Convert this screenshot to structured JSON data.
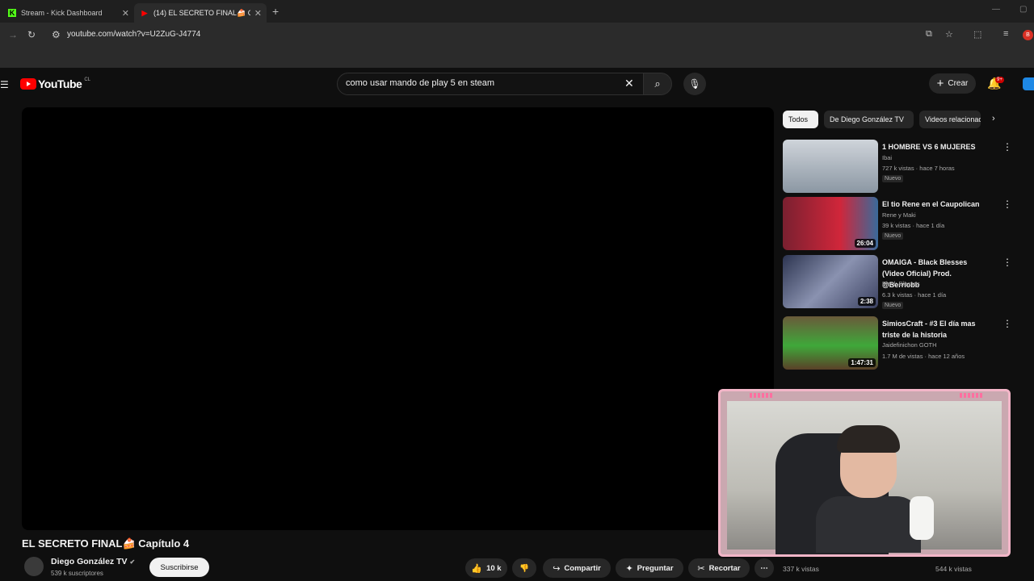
{
  "browser": {
    "tabs": [
      {
        "label": "Stream - Kick Dashboard",
        "favicon": "K"
      },
      {
        "label": "(14) EL SECRETO FINAL🍰 Capí",
        "favicon": "▶"
      }
    ],
    "url": "youtube.com/watch?v=U2ZuG-J4774",
    "profile_initial": "B"
  },
  "youtube": {
    "logo_text": "YouTube",
    "logo_country": "CL",
    "search_query": "como usar mando de play 5 en steam",
    "create_label": "Crear",
    "notification_count": "9+"
  },
  "video": {
    "title": "EL SECRETO FINAL🍰 Capítulo 4",
    "channel": "Diego González TV",
    "subscribers": "539 k suscriptores",
    "subscribe_label": "Suscribirse",
    "likes": "10 k",
    "share_label": "Compartir",
    "ask_label": "Preguntar",
    "clip_label": "Recortar"
  },
  "chips": [
    "Todos",
    "De Diego González TV",
    "Videos relacionados"
  ],
  "recommendations": [
    {
      "title": "1 HOMBRE VS 6 MUJERES",
      "channel": "Ibai",
      "meta": "727 k vistas · hace 7 horas",
      "badge": "Nuevo",
      "duration": "",
      "thumb_color": "#6f7d8c"
    },
    {
      "title": "El tio Rene en el Caupolican",
      "channel": "Rene y Maki",
      "meta": "39 k vistas · hace 1 día",
      "badge": "Nuevo",
      "duration": "26:04",
      "thumb_color": "#b8233a"
    },
    {
      "title": "OMAIGA - Black Blesses (Video Oficial) Prod. @Berriobb",
      "channel": "Black Blesses",
      "meta": "6.3 k vistas · hace 1 día",
      "badge": "Nuevo",
      "duration": "2:38",
      "thumb_color": "#3d4a6a"
    },
    {
      "title": "SimiosCraft - #3 El día mas triste de la historia",
      "channel": "Jaidefinichon GOTH",
      "meta": "1.7 M de vistas · hace 12 años",
      "badge": "",
      "duration": "1:47:31",
      "thumb_color": "#3f8d3a"
    }
  ],
  "bottom_views": [
    "337 k vistas",
    "544 k vistas"
  ]
}
